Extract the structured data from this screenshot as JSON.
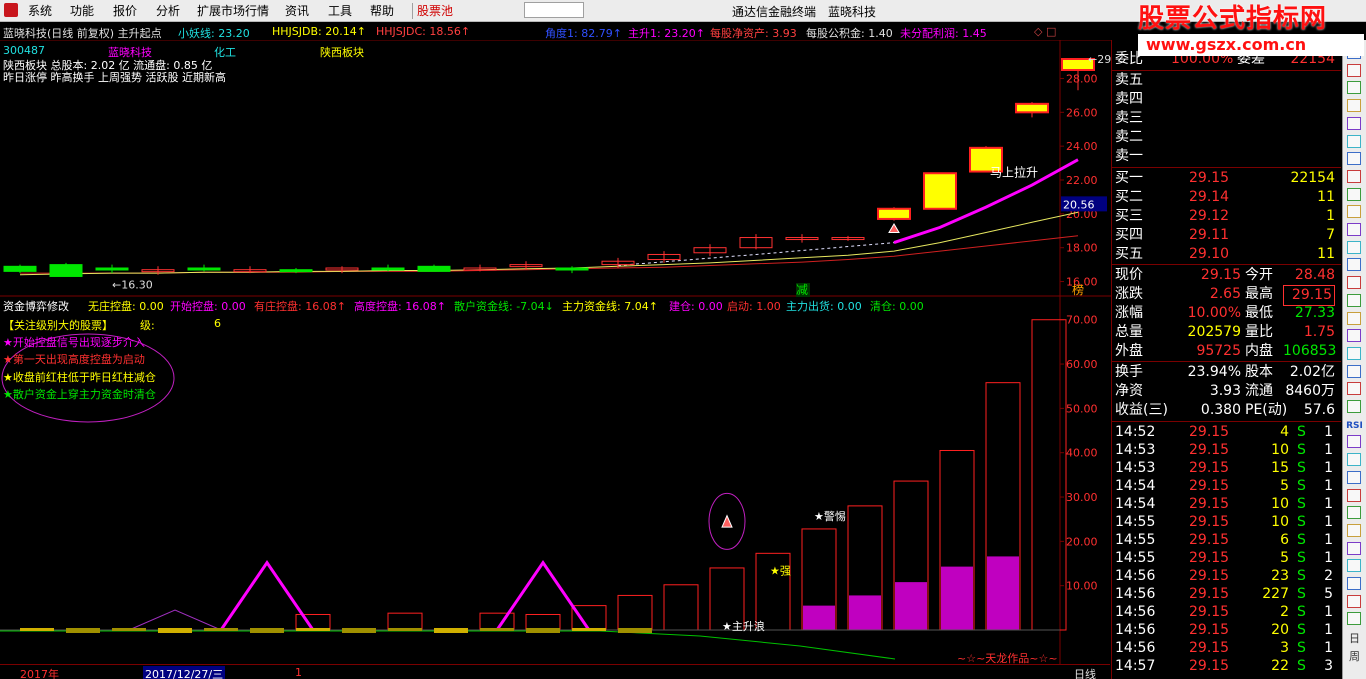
{
  "menubar": {
    "items": [
      "系统",
      "功能",
      "报价",
      "分析",
      "扩展市场行情",
      "资讯",
      "工具",
      "帮助"
    ],
    "stock_pool": "股票池",
    "app_title": "通达信金融终端",
    "stock_name": "蓝晓科技"
  },
  "watermark": {
    "title": "股票公式指标网",
    "url": "www.gszx.com.cn"
  },
  "header": {
    "title": "蓝晓科技(日线 前复权) 主升起点",
    "ind1": "小妖线: 23.20",
    "ind2": "HHJSJDB: 20.14↑",
    "ind3": "HHJSJDC: 18.56↑",
    "ind4": "角度1: 82.79↑",
    "ind5": "主升1: 23.20↑",
    "ind6": "每股净资产: 3.93",
    "ind7": "每股公积金: 1.40",
    "ind8": "未分配利润: 1.45",
    "marks": "◇ □"
  },
  "info": {
    "code": "300487",
    "name": "蓝晓科技",
    "industry": "化工",
    "region": "陕西板块",
    "line2": "陕西板块  总股本: 2.02 亿   流通盘: 0.85 亿",
    "line3": "昨日涨停 昨高换手 上周强势 活跃股 近期新高"
  },
  "chart_data": [
    {
      "type": "candlestick",
      "title": "蓝晓科技(日线 前复权) 主升起点",
      "ylim": [
        15.5,
        29.8
      ],
      "yticks": [
        "28.00",
        "26.00",
        "24.00",
        "22.00",
        "20.00",
        "18.00",
        "16.00"
      ],
      "crosshair_price": "20.56",
      "low_label": "←16.30",
      "high_label": "←29.15",
      "annotations": [
        "马上拉升",
        "减",
        "榜"
      ],
      "candles": [
        {
          "o": 16.9,
          "c": 16.6,
          "h": 17.0,
          "l": 16.5
        },
        {
          "o": 17.0,
          "c": 16.3,
          "h": 17.1,
          "l": 16.3
        },
        {
          "o": 16.8,
          "c": 16.7,
          "h": 17.0,
          "l": 16.5
        },
        {
          "o": 16.6,
          "c": 16.7,
          "h": 16.9,
          "l": 16.4
        },
        {
          "o": 16.8,
          "c": 16.7,
          "h": 17.0,
          "l": 16.6
        },
        {
          "o": 16.6,
          "c": 16.7,
          "h": 16.9,
          "l": 16.5
        },
        {
          "o": 16.7,
          "c": 16.6,
          "h": 16.8,
          "l": 16.5
        },
        {
          "o": 16.7,
          "c": 16.8,
          "h": 16.9,
          "l": 16.5
        },
        {
          "o": 16.8,
          "c": 16.7,
          "h": 17.0,
          "l": 16.6
        },
        {
          "o": 16.9,
          "c": 16.6,
          "h": 17.0,
          "l": 16.6
        },
        {
          "o": 16.8,
          "c": 16.8,
          "h": 17.0,
          "l": 16.6
        },
        {
          "o": 16.9,
          "c": 17.0,
          "h": 17.2,
          "l": 16.7
        },
        {
          "o": 16.8,
          "c": 16.7,
          "h": 16.9,
          "l": 16.5
        },
        {
          "o": 17.0,
          "c": 17.2,
          "h": 17.4,
          "l": 16.8
        },
        {
          "o": 17.3,
          "c": 17.6,
          "h": 17.8,
          "l": 17.1
        },
        {
          "o": 17.7,
          "c": 18.0,
          "h": 18.2,
          "l": 17.5
        },
        {
          "o": 18.0,
          "c": 18.6,
          "h": 18.8,
          "l": 17.9
        },
        {
          "o": 18.5,
          "c": 18.6,
          "h": 18.8,
          "l": 18.3
        },
        {
          "o": 18.6,
          "c": 18.6,
          "h": 18.7,
          "l": 18.4
        },
        {
          "o": 19.7,
          "c": 20.3,
          "h": 20.4,
          "l": 19.6
        },
        {
          "o": 20.3,
          "c": 22.4,
          "h": 22.4,
          "l": 20.3
        },
        {
          "o": 22.5,
          "c": 23.9,
          "h": 24.0,
          "l": 22.5
        },
        {
          "o": 26.0,
          "c": 26.5,
          "h": 26.6,
          "l": 25.7
        },
        {
          "o": 28.5,
          "c": 29.15,
          "h": 29.15,
          "l": 27.3
        }
      ],
      "lines": {
        "ma_yellow": [
          16.4,
          16.45,
          16.5,
          16.5,
          16.55,
          16.55,
          16.6,
          16.6,
          16.65,
          16.65,
          16.7,
          16.75,
          16.8,
          16.9,
          17.0,
          17.1,
          17.25,
          17.4,
          17.55,
          17.8,
          18.3,
          18.9,
          19.5,
          20.1
        ],
        "ma_red": [
          16.5,
          16.5,
          16.5,
          16.5,
          16.55,
          16.55,
          16.55,
          16.6,
          16.6,
          16.6,
          16.65,
          16.7,
          16.75,
          16.8,
          16.85,
          16.95,
          17.05,
          17.15,
          17.3,
          17.5,
          17.8,
          18.1,
          18.4,
          18.7
        ],
        "xiaoyao_magenta": [
          null,
          null,
          null,
          null,
          null,
          null,
          null,
          null,
          null,
          null,
          null,
          null,
          null,
          null,
          null,
          null,
          null,
          null,
          null,
          18.3,
          19.2,
          20.4,
          21.7,
          23.2
        ]
      }
    },
    {
      "type": "bar",
      "title": "资金博弈修改",
      "ylim": [
        0,
        74
      ],
      "yticks": [
        "70.00",
        "60.00",
        "50.00",
        "40.00",
        "30.00",
        "20.00",
        "10.00"
      ],
      "indicators": [
        "无庄控盘: 0.00",
        "开始控盘: 0.00",
        "有庄控盘: 16.08↑",
        "高度控盘: 16.08↑",
        "散户资金线: -7.04↓",
        "主力资金线: 7.04↑",
        "建仓: 0.00",
        "启动: 1.00",
        "主力出货: 0.00",
        "清仓: 0.00"
      ],
      "control_values": [
        0,
        0,
        0,
        0,
        0,
        0,
        3.5,
        0,
        3.8,
        0,
        3.8,
        3.5,
        5.5,
        7.8,
        10.2,
        14.0,
        17.3,
        22.8,
        28.0,
        33.6,
        40.5,
        55.8,
        70.0
      ],
      "magenta_fill": [
        0,
        0,
        0,
        0,
        0,
        0,
        0,
        0,
        0,
        0,
        0,
        0,
        0,
        0,
        0,
        0,
        0,
        5.5,
        7.8,
        10.8,
        14.3,
        16.6
      ],
      "annotations": [
        "★主升浪",
        "★强",
        "★警惕"
      ]
    }
  ],
  "legend": {
    "title": "【关注级别大的股票】",
    "level_label": "级:",
    "level_value": "6",
    "items": [
      "★开始控盘信号出现逐步介入",
      "★第一天出现高度控盘为启动",
      "★收盘前红柱低于昨日红柱减仓",
      "★散户资金上穿主力资金时清仓"
    ],
    "author": "~☆~天龙作品~☆~"
  },
  "status": {
    "year": "2017年",
    "date": "2017/12/27/三",
    "num": "1",
    "period": "日线"
  },
  "quote": {
    "weibi_label": "委比",
    "weibi": "100.00%",
    "weicha_label": "委差",
    "weicha": "22154",
    "sells": [
      {
        "label": "卖五"
      },
      {
        "label": "卖四"
      },
      {
        "label": "卖三"
      },
      {
        "label": "卖二"
      },
      {
        "label": "卖一"
      }
    ],
    "buys": [
      {
        "label": "买一",
        "price": "29.15",
        "vol": "22154"
      },
      {
        "label": "买二",
        "price": "29.14",
        "vol": "11"
      },
      {
        "label": "买三",
        "price": "29.12",
        "vol": "1"
      },
      {
        "label": "买四",
        "price": "29.11",
        "vol": "7"
      },
      {
        "label": "买五",
        "price": "29.10",
        "vol": "11"
      }
    ],
    "stats": [
      {
        "l1": "现价",
        "v1": "29.15",
        "l2": "今开",
        "v2": "28.48"
      },
      {
        "l1": "涨跌",
        "v1": "2.65",
        "l2": "最高",
        "v2": "29.15"
      },
      {
        "l1": "涨幅",
        "v1": "10.00%",
        "l2": "最低",
        "v2": "27.33"
      },
      {
        "l1": "总量",
        "v1": "202579",
        "l2": "量比",
        "v2": "1.75"
      },
      {
        "l1": "外盘",
        "v1": "95725",
        "l2": "内盘",
        "v2": "106853"
      }
    ],
    "finance": [
      {
        "l1": "换手",
        "v1": "23.94%",
        "l2": "股本",
        "v2": "2.02亿"
      },
      {
        "l1": "净资",
        "v1": "3.93",
        "l2": "流通",
        "v2": "8460万"
      },
      {
        "l1": "收益(三)",
        "v1": "0.380",
        "l2": "PE(动)",
        "v2": "57.6"
      }
    ],
    "ticks": [
      {
        "t": "14:52",
        "p": "29.15",
        "v": "4",
        "s": "S",
        "n": "1"
      },
      {
        "t": "14:53",
        "p": "29.15",
        "v": "10",
        "s": "S",
        "n": "1"
      },
      {
        "t": "14:53",
        "p": "29.15",
        "v": "15",
        "s": "S",
        "n": "1"
      },
      {
        "t": "14:54",
        "p": "29.15",
        "v": "5",
        "s": "S",
        "n": "1"
      },
      {
        "t": "14:54",
        "p": "29.15",
        "v": "10",
        "s": "S",
        "n": "1"
      },
      {
        "t": "14:55",
        "p": "29.15",
        "v": "10",
        "s": "S",
        "n": "1"
      },
      {
        "t": "14:55",
        "p": "29.15",
        "v": "6",
        "s": "S",
        "n": "1"
      },
      {
        "t": "14:55",
        "p": "29.15",
        "v": "5",
        "s": "S",
        "n": "1"
      },
      {
        "t": "14:56",
        "p": "29.15",
        "v": "23",
        "s": "S",
        "n": "2"
      },
      {
        "t": "14:56",
        "p": "29.15",
        "v": "227",
        "s": "S",
        "n": "5"
      },
      {
        "t": "14:56",
        "p": "29.15",
        "v": "2",
        "s": "S",
        "n": "1"
      },
      {
        "t": "14:56",
        "p": "29.15",
        "v": "20",
        "s": "S",
        "n": "1"
      },
      {
        "t": "14:56",
        "p": "29.15",
        "v": "3",
        "s": "S",
        "n": "1"
      },
      {
        "t": "14:57",
        "p": "29.15",
        "v": "22",
        "s": "S",
        "n": "3"
      }
    ]
  },
  "toolbar_icons": [
    "icon-a",
    "icon-b",
    "icon-c",
    "icon-d",
    "icon-e",
    "icon-f",
    "icon-g",
    "icon-h",
    "icon-i",
    "icon-j",
    "icon-k",
    "icon-l",
    "icon-m",
    "icon-n",
    "icon-o",
    "icon-p",
    "icon-q",
    "icon-r",
    "icon-s",
    "icon-t",
    "icon-u",
    "icon-v",
    "icon-w",
    "icon-x",
    "icon-y",
    "icon-z",
    "icon-aa",
    "icon-bb",
    "icon-cc",
    "icon-dd",
    "icon-ee",
    "icon-ff",
    "icon-gg",
    "icon-hh",
    "icon-ii"
  ],
  "toolbar_text": {
    "rsi": "RSI",
    "day": "日",
    "week": "周"
  },
  "colors": {
    "up": "#ff3232",
    "down": "#00e600",
    "magenta": "#ff00ff",
    "yellow": "#ffff00",
    "frame": "#7a0000"
  }
}
